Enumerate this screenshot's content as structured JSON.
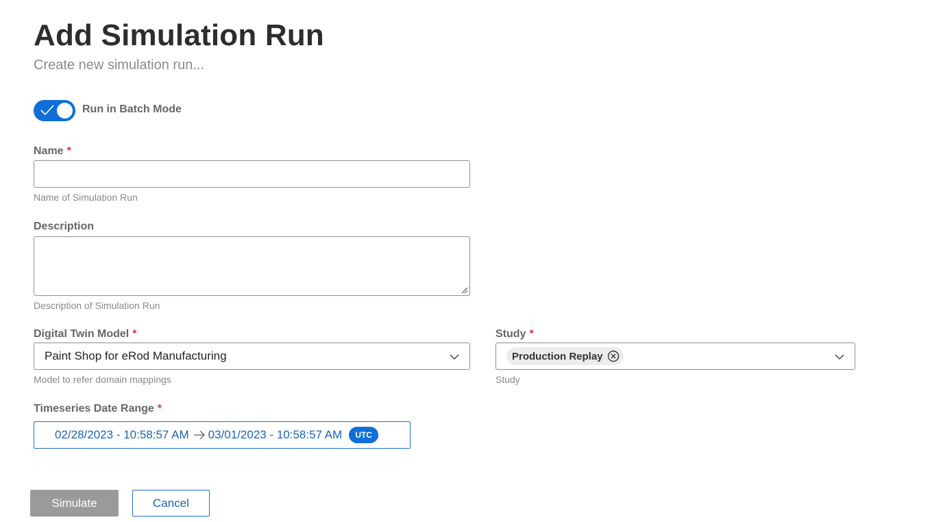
{
  "header": {
    "title": "Add Simulation Run",
    "subtitle": "Create new simulation run..."
  },
  "batch_mode": {
    "label": "Run in Batch Mode",
    "enabled": true
  },
  "form": {
    "name": {
      "label": "Name",
      "required_mark": "*",
      "value": "",
      "hint": "Name of Simulation Run"
    },
    "description": {
      "label": "Description",
      "value": "",
      "hint": "Description of Simulation Run"
    },
    "digital_twin_model": {
      "label": "Digital Twin Model",
      "required_mark": "*",
      "selected": "Paint Shop for eRod Manufacturing",
      "hint": "Model to refer domain mappings"
    },
    "study": {
      "label": "Study",
      "required_mark": "*",
      "selected_chips": [
        "Production Replay"
      ],
      "hint": "Study"
    },
    "timeseries_date_range": {
      "label": "Timeseries Date Range",
      "required_mark": "*",
      "start": "02/28/2023 - 10:58:57 AM",
      "end": "03/01/2023 - 10:58:57 AM",
      "timezone": "UTC"
    }
  },
  "actions": {
    "simulate_label": "Simulate",
    "cancel_label": "Cancel"
  },
  "colors": {
    "primary": "#0f6fd6",
    "required": "#d9363e",
    "disabled_button": "#9a9a9a"
  }
}
